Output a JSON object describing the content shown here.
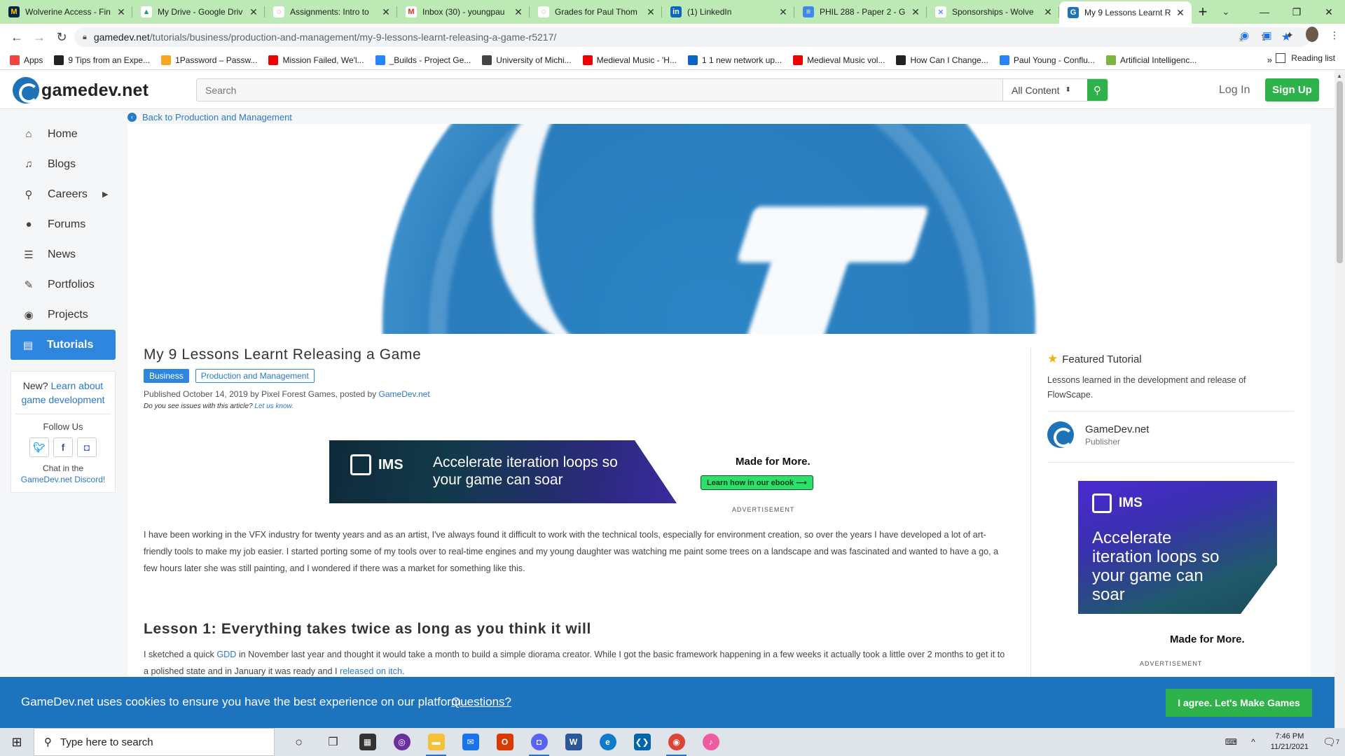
{
  "browser": {
    "tabs": [
      {
        "title": "Wolverine Access - Fin",
        "favicon": "M",
        "color": "#00274c",
        "fg": "#ffcb05"
      },
      {
        "title": "My Drive - Google Driv",
        "favicon": "▲",
        "color": "#fff",
        "fg": "#1fa463"
      },
      {
        "title": "Assignments: Intro to",
        "favicon": "◌",
        "color": "#fff",
        "fg": "#e0462a"
      },
      {
        "title": "Inbox (30) - youngpau",
        "favicon": "M",
        "color": "#fff",
        "fg": "#d93025"
      },
      {
        "title": "Grades for Paul Thom",
        "favicon": "◌",
        "color": "#fff",
        "fg": "#e0462a"
      },
      {
        "title": "(1) LinkedIn",
        "favicon": "in",
        "color": "#0a66c2",
        "fg": "#fff"
      },
      {
        "title": "PHIL 288 - Paper 2 - G",
        "favicon": "≡",
        "color": "#4285f4",
        "fg": "#fff"
      },
      {
        "title": "Sponsorships - Wolve",
        "favicon": "✕",
        "color": "#fff",
        "fg": "#2684ff"
      },
      {
        "title": "My 9 Lessons Learnt R",
        "favicon": "G",
        "color": "#1e73b8",
        "fg": "#fff",
        "active": true
      }
    ],
    "new_tab": "+",
    "url_host": "gamedev.net",
    "url_path": "/tutorials/business/production-and-management/my-9-lessons-learnt-releasing-a-game-r5217/",
    "bookmarks": [
      {
        "label": "Apps",
        "color": "#e44"
      },
      {
        "label": "9 Tips from an Expe...",
        "color": "#222"
      },
      {
        "label": "1Password – Passw...",
        "color": "#f5a623"
      },
      {
        "label": "Mission Failed, We'l...",
        "color": "#e00"
      },
      {
        "label": "_Builds - Project Ge...",
        "color": "#2684ff"
      },
      {
        "label": "University of Michi...",
        "color": "#444"
      },
      {
        "label": "Medieval Music - 'H...",
        "color": "#e00"
      },
      {
        "label": "1 1 new network up...",
        "color": "#0a66c2"
      },
      {
        "label": "Medieval Music vol...",
        "color": "#e00"
      },
      {
        "label": "How Can I Change...",
        "color": "#222"
      },
      {
        "label": "Paul Young - Conflu...",
        "color": "#2684ff"
      },
      {
        "label": "Artificial Intelligenc...",
        "color": "#7cb342"
      }
    ],
    "bookmarks_more": "»",
    "reading_list": "Reading list"
  },
  "site": {
    "logo_text": "gamedev.net",
    "search_placeholder": "Search",
    "search_scope": "All Content",
    "login": "Log In",
    "signup": "Sign Up"
  },
  "sidebar": {
    "items": [
      {
        "label": "Home",
        "icon": "⌂",
        "name": "home"
      },
      {
        "label": "Blogs",
        "icon": "♫",
        "name": "blogs"
      },
      {
        "label": "Careers",
        "icon": "⚲",
        "name": "careers",
        "has_caret": true
      },
      {
        "label": "Forums",
        "icon": "●",
        "name": "forums"
      },
      {
        "label": "News",
        "icon": "☰",
        "name": "news"
      },
      {
        "label": "Portfolios",
        "icon": "✎",
        "name": "portfolios"
      },
      {
        "label": "Projects",
        "icon": "◉",
        "name": "projects"
      },
      {
        "label": "Tutorials",
        "icon": "▤",
        "name": "tutorials",
        "active": true
      }
    ],
    "new_prefix": "New?",
    "new_link": "Learn about game development",
    "follow_us": "Follow Us",
    "chat_prefix": "Chat in the",
    "chat_link": "GameDev.net Discord!"
  },
  "article": {
    "back_link": "Back to Production and Management",
    "title": "My 9 Lessons Learnt Releasing a Game",
    "tag_primary": "Business",
    "tag_secondary": "Production and Management",
    "published": "Published October 14, 2019 by Pixel Forest Games, posted by",
    "posted_by": "GameDev.net",
    "issues_prefix": "Do you see issues with this article?",
    "issues_link": "Let us know.",
    "paragraph1": "I have been working in the VFX industry for twenty years and as an artist, I've always found it difficult to work with the technical tools, especially for environment creation, so over the years I have developed a lot of art-friendly tools to make my job easier. I started porting some of my tools over to real-time engines and my young daughter was watching me paint some trees on a landscape and was fascinated and wanted to have a go, a few hours later she was still painting, and I wondered if there was a market for something like this.",
    "lesson1_heading": "Lesson 1: Everything takes twice as long as you think it will",
    "lesson1_a": "I sketched a quick",
    "lesson1_gdd": "GDD",
    "lesson1_b": "in November last year and thought it would take a month to build a simple diorama creator. While I got the basic framework happening in a few weeks it actually took a little over 2 months to get it to a polished state and in January it was ready and I",
    "lesson1_link": "released on itch",
    "lesson1_c": "."
  },
  "ads": {
    "brand": "IMS",
    "headline_wide": "Accelerate iteration loops so your game can soar",
    "made_for_more": "Made for More.",
    "cta": "Learn how in our ebook ⟶",
    "label": "ADVERTISEMENT",
    "headline_side": "Accelerate iteration loops so your game can soar"
  },
  "featured": {
    "heading": "Featured Tutorial",
    "description": "Lessons learned in the development and release of FlowScape.",
    "publisher_name": "GameDev.net",
    "publisher_role": "Publisher"
  },
  "cookie": {
    "text": "GameDev.net uses cookies to ensure you have the best experience on our platform.",
    "link": "Questions?",
    "button": "I agree. Let's Make Games"
  },
  "taskbar": {
    "search_placeholder": "Type here to search",
    "time": "7:46 PM",
    "date": "11/21/2021",
    "notification_count": "7"
  }
}
